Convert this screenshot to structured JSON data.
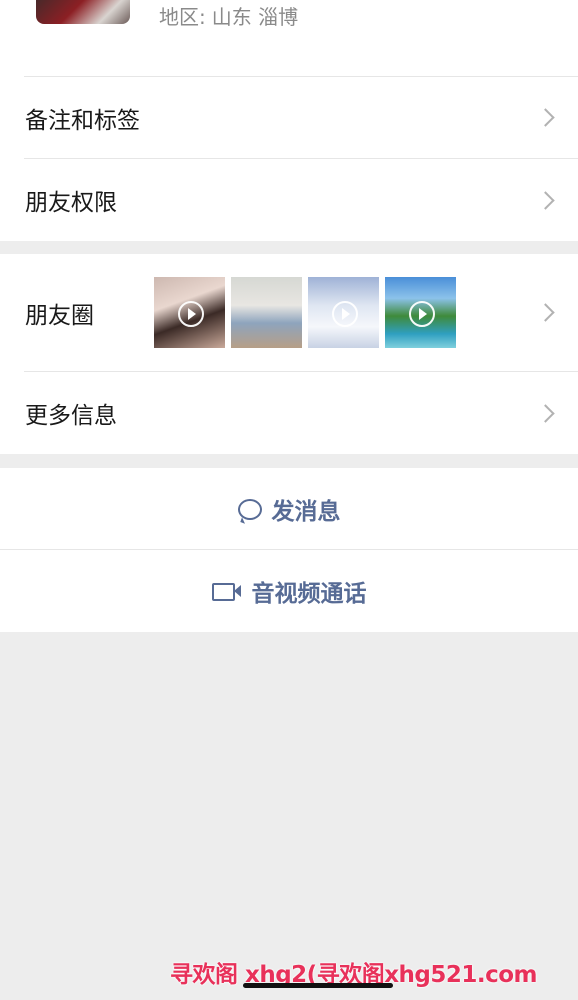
{
  "profile": {
    "region_label": "地区:",
    "region_value": "山东 淄博"
  },
  "menu": {
    "remark_tags": "备注和标签",
    "friend_permissions": "朋友权限",
    "moments": "朋友圈",
    "more_info": "更多信息"
  },
  "moments_thumbs": [
    {
      "kind": "video"
    },
    {
      "kind": "photo"
    },
    {
      "kind": "video"
    },
    {
      "kind": "video"
    }
  ],
  "actions": {
    "send_message": "发消息",
    "av_call": "音视频通话"
  },
  "watermark": "寻欢阁 xhg2(寻欢阁xhg521.com",
  "colors": {
    "link_blue": "#576b95",
    "background": "#ededed",
    "card": "#ffffff",
    "watermark": "#e8315a"
  },
  "icons": [
    "chevron-right-icon",
    "play-icon",
    "chat-bubble-icon",
    "video-camera-icon"
  ]
}
